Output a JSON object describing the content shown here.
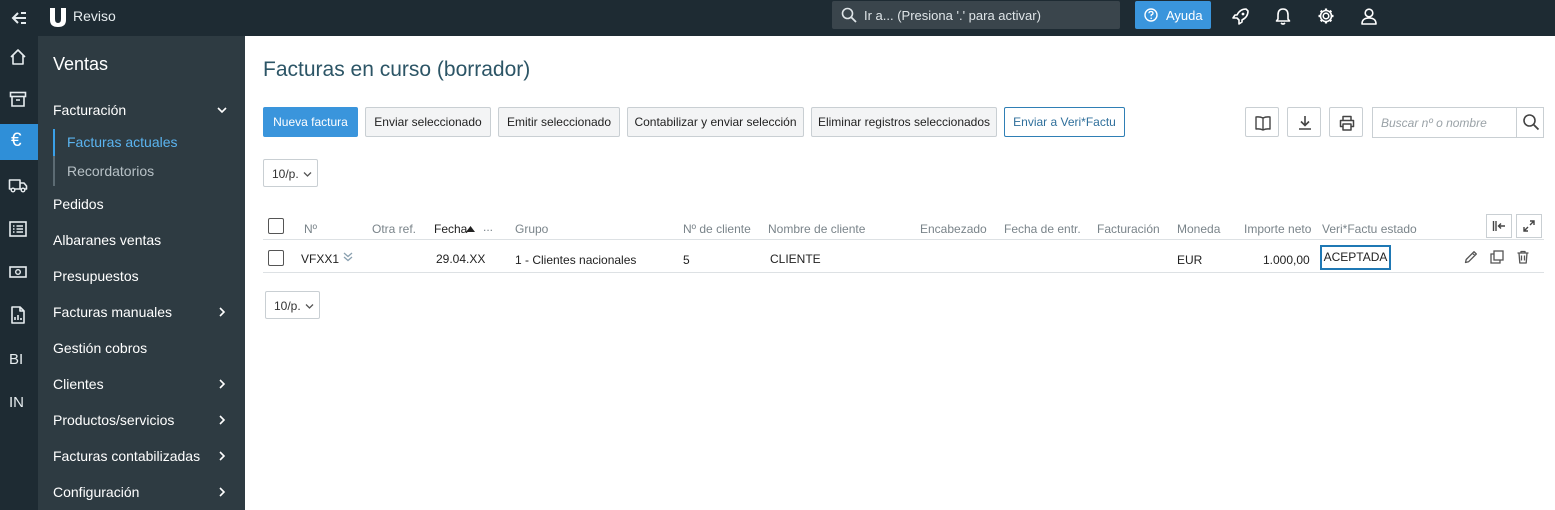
{
  "app": {
    "brand": "Reviso"
  },
  "topbar": {
    "search_placeholder": "Ir a... (Presiona '.' para activar)",
    "help_label": "Ayuda"
  },
  "rail": {
    "bi": "BI",
    "in": "IN",
    "currency": "€"
  },
  "sidebar": {
    "title": "Ventas",
    "facturacion": "Facturación",
    "facturas_actuales": "Facturas actuales",
    "recordatorios": "Recordatorios",
    "pedidos": "Pedidos",
    "albaranes": "Albaranes ventas",
    "presupuestos": "Presupuestos",
    "facturas_manuales": "Facturas manuales",
    "gestion_cobros": "Gestión cobros",
    "clientes": "Clientes",
    "productos": "Productos/servicios",
    "facturas_contabilizadas": "Facturas contabilizadas",
    "configuracion": "Configuración"
  },
  "main": {
    "title": "Facturas en curso (borrador)",
    "toolbar": {
      "nueva": "Nueva factura",
      "enviar": "Enviar seleccionado",
      "emitir": "Emitir seleccionado",
      "contabilizar": "Contabilizar y enviar selección",
      "eliminar": "Eliminar registros seleccionados",
      "verifactu": "Enviar a Veri*Factu"
    },
    "search_placeholder": "Buscar nº o nombre",
    "page_size": "10/p.",
    "columns": {
      "numero": "Nº",
      "otra_ref": "Otra ref.",
      "fecha": "Fecha",
      "fecha_more": "...",
      "grupo": "Grupo",
      "n_cliente": "Nº de cliente",
      "nombre_cliente": "Nombre de cliente",
      "encabezado": "Encabezado",
      "fecha_entr": "Fecha de entr.",
      "facturacion": "Facturación",
      "moneda": "Moneda",
      "importe": "Importe neto",
      "estado": "Veri*Factu estado"
    },
    "rows": [
      {
        "numero": "VFXX1",
        "fecha": "29.04.XX",
        "grupo": "1 - Clientes nacionales",
        "n_cliente": "5",
        "nombre_cliente": "CLIENTE",
        "moneda": "EUR",
        "importe": "1.000,00",
        "estado": "ACEPTADA"
      }
    ]
  },
  "colors": {
    "accent": "#3a95dc",
    "topbar": "#1e2b33",
    "sidebar": "#2e3b42",
    "status_border": "#1f78b4"
  }
}
